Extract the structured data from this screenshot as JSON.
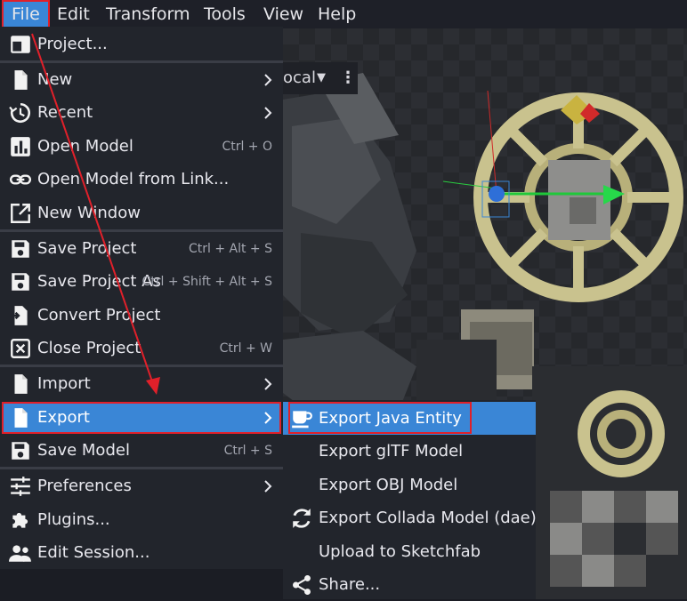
{
  "menubar": {
    "items": [
      "File",
      "Edit",
      "Transform",
      "Tools",
      "View",
      "Help"
    ]
  },
  "toolbar": {
    "space_label": "ocal"
  },
  "file_menu": {
    "items": [
      {
        "label": "Project...",
        "shortcut": "",
        "icon": "project-icon",
        "submenu": false
      },
      {
        "label": "New",
        "shortcut": "",
        "icon": "file-icon",
        "submenu": true
      },
      {
        "label": "Recent",
        "shortcut": "",
        "icon": "history-icon",
        "submenu": true
      },
      {
        "label": "Open Model",
        "shortcut": "Ctrl + O",
        "icon": "chart-icon",
        "submenu": false
      },
      {
        "label": "Open Model from Link...",
        "shortcut": "",
        "icon": "link-icon",
        "submenu": false
      },
      {
        "label": "New Window",
        "shortcut": "",
        "icon": "open-new-icon",
        "submenu": false
      },
      {
        "label": "Save Project",
        "shortcut": "Ctrl + Alt + S",
        "icon": "save-icon",
        "submenu": false
      },
      {
        "label": "Save Project As",
        "shortcut": "Ctrl + Shift + Alt + S",
        "icon": "save-icon",
        "submenu": false
      },
      {
        "label": "Convert Project",
        "shortcut": "",
        "icon": "convert-icon",
        "submenu": false
      },
      {
        "label": "Close Project",
        "shortcut": "Ctrl + W",
        "icon": "close-box-icon",
        "submenu": false
      },
      {
        "label": "Import",
        "shortcut": "",
        "icon": "file-icon",
        "submenu": true
      },
      {
        "label": "Export",
        "shortcut": "",
        "icon": "file-icon",
        "submenu": true
      },
      {
        "label": "Save Model",
        "shortcut": "Ctrl + S",
        "icon": "save-icon",
        "submenu": false
      },
      {
        "label": "Preferences",
        "shortcut": "",
        "icon": "sliders-icon",
        "submenu": true
      },
      {
        "label": "Plugins...",
        "shortcut": "",
        "icon": "puzzle-icon",
        "submenu": false
      },
      {
        "label": "Edit Session...",
        "shortcut": "",
        "icon": "people-icon",
        "submenu": false
      }
    ]
  },
  "export_menu": {
    "items": [
      {
        "label": "Export Java Entity",
        "icon": "coffee-icon"
      },
      {
        "label": "Export glTF Model",
        "icon": ""
      },
      {
        "label": "Export OBJ Model",
        "icon": ""
      },
      {
        "label": "Export Collada Model (dae)",
        "icon": "refresh-icon"
      },
      {
        "label": "Upload to Sketchfab",
        "icon": ""
      },
      {
        "label": "Share...",
        "icon": "share-icon"
      }
    ]
  },
  "colors": {
    "accent": "#3a86d6",
    "highlight": "#e0202a",
    "menu_bg": "#22252c",
    "viewport_bg": "#2c2e33"
  }
}
